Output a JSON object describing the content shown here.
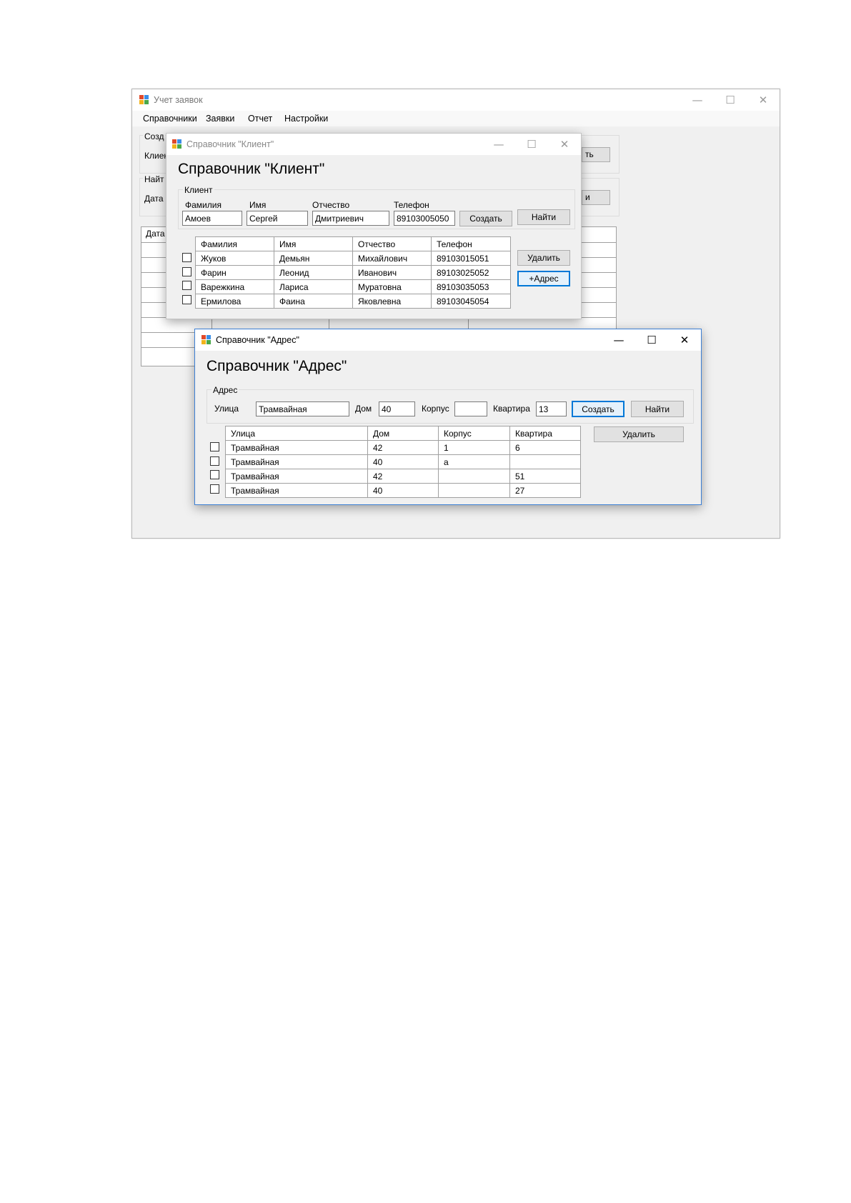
{
  "main_window": {
    "title": "Учет заявок",
    "menu": [
      "Справочники",
      "Заявки",
      "Отчет",
      "Настройки"
    ],
    "group_create_label": "Созд",
    "group_create_field": "Клиен",
    "group_create_button": "ть",
    "group_find_label": "Найт",
    "group_find_field": "Дата",
    "group_find_button": "и",
    "grid_header": "Дата"
  },
  "window_controls": {
    "minimize": "—",
    "maximize": "☐",
    "close": "✕"
  },
  "client_dialog": {
    "title": "Справочник \"Клиент\"",
    "heading": "Справочник \"Клиент\"",
    "group_label": "Клиент",
    "labels": {
      "last_name": "Фамилия",
      "first_name": "Имя",
      "patronymic": "Отчество",
      "phone": "Телефон"
    },
    "inputs": {
      "last_name": "Амоев",
      "first_name": "Сергей",
      "patronymic": "Дмитриевич",
      "phone": "89103005050"
    },
    "buttons": {
      "create": "Создать",
      "find": "Найти",
      "delete": "Удалить",
      "add_address": "+Адрес"
    },
    "table": {
      "columns": [
        "Фамилия",
        "Имя",
        "Отчество",
        "Телефон"
      ],
      "rows": [
        [
          "Жуков",
          "Демьян",
          "Михайлович",
          "89103015051"
        ],
        [
          "Фарин",
          "Леонид",
          "Иванович",
          "89103025052"
        ],
        [
          "Варежкина",
          "Лариса",
          "Муратовна",
          "89103035053"
        ],
        [
          "Ермилова",
          "Фаина",
          "Яковлевна",
          "89103045054"
        ]
      ]
    }
  },
  "address_dialog": {
    "title": "Справочник \"Адрес\"",
    "heading": "Справочник \"Адрес\"",
    "group_label": "Адрес",
    "labels": {
      "street": "Улица",
      "house": "Дом",
      "building": "Корпус",
      "apartment": "Квартира"
    },
    "inputs": {
      "street": "Трамвайная",
      "house": "40",
      "building": "",
      "apartment": "13"
    },
    "buttons": {
      "create": "Создать",
      "find": "Найти",
      "delete": "Удалить"
    },
    "table": {
      "columns": [
        "Улица",
        "Дом",
        "Корпус",
        "Квартира"
      ],
      "rows": [
        [
          "Трамвайная",
          "42",
          "1",
          "6"
        ],
        [
          "Трамвайная",
          "40",
          "а",
          ""
        ],
        [
          "Трамвайная",
          "42",
          "",
          "51"
        ],
        [
          "Трамвайная",
          "40",
          "",
          "27"
        ]
      ]
    }
  }
}
